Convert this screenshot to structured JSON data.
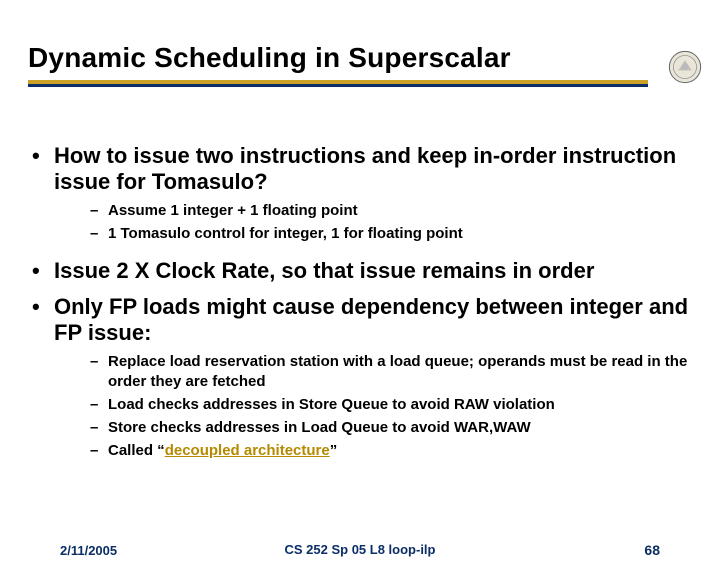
{
  "title": "Dynamic Scheduling in Superscalar",
  "bullets": [
    {
      "text": "How to issue two instructions and keep in-order instruction issue for Tomasulo?",
      "sub": [
        "Assume 1 integer + 1 floating point",
        "1 Tomasulo control for integer, 1 for floating point"
      ]
    },
    {
      "text": "Issue 2 X Clock Rate, so that issue remains in order",
      "sub": []
    },
    {
      "text": "Only FP loads might cause dependency between integer and FP issue:",
      "sub": [
        "Replace load reservation station with a load queue; operands must be read in the order they are fetched",
        "Load checks addresses in Store Queue to avoid RAW violation",
        "Store checks addresses in Load Queue to avoid WAR,WAW",
        "Called “__EM__decoupled architecture__/EM__”"
      ]
    }
  ],
  "footer": {
    "date": "2/11/2005",
    "course": "CS 252 Sp 05 L8 loop-ilp",
    "page": "68"
  },
  "icons": {
    "logo_alt": "university-seal"
  }
}
